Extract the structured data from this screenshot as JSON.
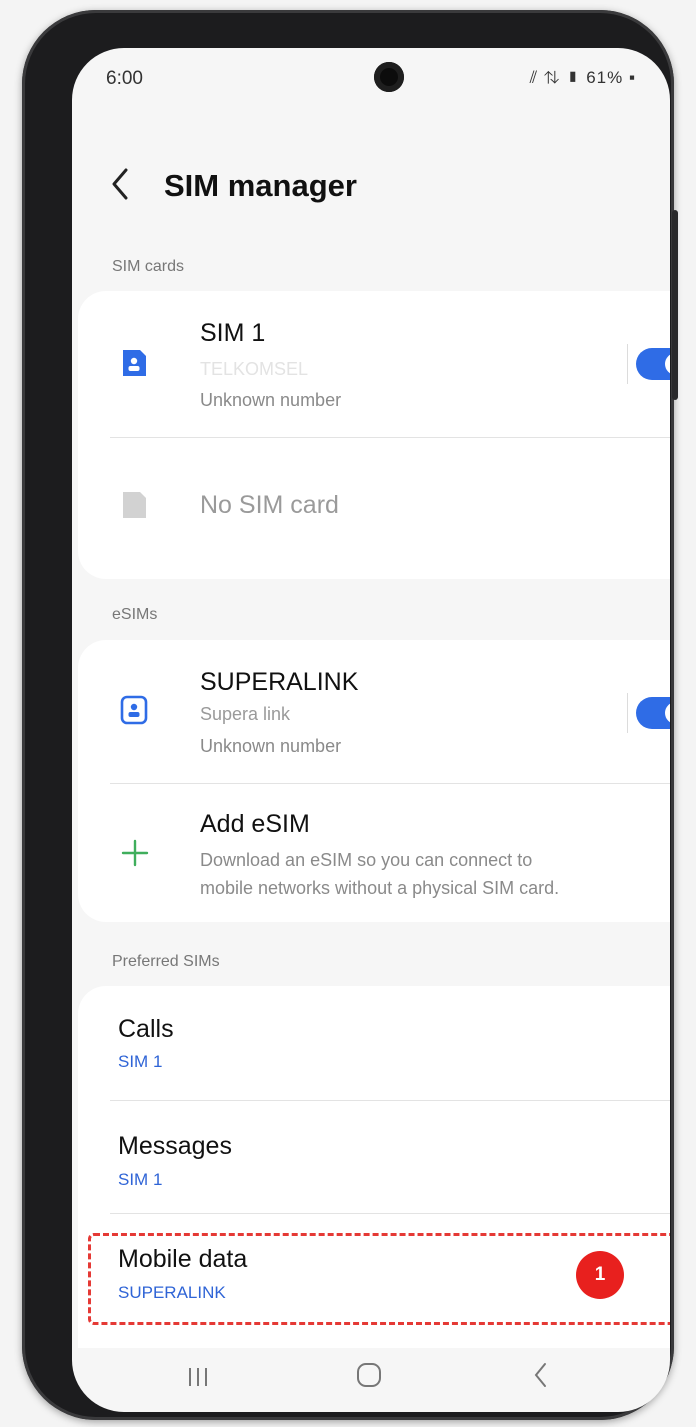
{
  "status": {
    "time": "6:00",
    "icons": "◀︎ ⏚ ⇅ ▮ 61%▪",
    "battery": "61%"
  },
  "header": {
    "title": "SIM manager",
    "back_glyph": "‹"
  },
  "sections": {
    "sim_cards": "SIM cards",
    "esims": "eSIMs",
    "preferred": "Preferred SIMs"
  },
  "sim_cards": [
    {
      "name": "SIM 1",
      "carrier": "TELKOMSEL",
      "number": "Unknown number",
      "enabled": true
    },
    {
      "name": "No SIM card"
    }
  ],
  "esims": {
    "items": [
      {
        "name": "SUPERALINK",
        "carrier": "Supera link",
        "number": "Unknown number",
        "enabled": true
      }
    ],
    "add": {
      "title": "Add eSIM",
      "description_line1": "Download an eSIM so you can connect to",
      "description_line2": "mobile networks without a physical SIM card."
    }
  },
  "preferred": {
    "calls": {
      "label": "Calls",
      "value": "SIM 1"
    },
    "messages": {
      "label": "Messages",
      "value": "SIM 1"
    },
    "mobile_data": {
      "label": "Mobile data",
      "value": "SUPERALINK"
    }
  },
  "annotation": {
    "step": "1",
    "color": "#e53935"
  },
  "colors": {
    "accent": "#2f6ce6",
    "link": "#2f64d6",
    "add_icon": "#3fae5c"
  },
  "nav": {
    "recents": "|||",
    "home": "○",
    "back": "‹"
  }
}
